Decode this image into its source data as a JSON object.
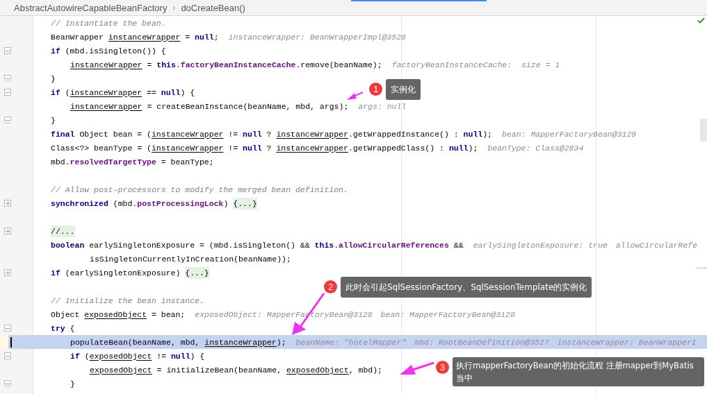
{
  "breadcrumb": {
    "class": "AbstractAutowireCapableBeanFactory",
    "separator": "›",
    "method": "doCreateBean()"
  },
  "lines": [
    {
      "current": false,
      "tokens": [
        {
          "text": "// Instantiate the bean.",
          "kind": "comment"
        }
      ]
    },
    {
      "current": false,
      "tokens": [
        {
          "text": "BeanWrapper ",
          "kind": "plain"
        },
        {
          "text": "instanceWrapper",
          "kind": "var"
        },
        {
          "text": " = ",
          "kind": "plain"
        },
        {
          "text": "null",
          "kind": "keyword"
        },
        {
          "text": ";",
          "kind": "plain"
        }
      ],
      "hints": [
        "instanceWrapper: BeanWrapperImpl@3528"
      ]
    },
    {
      "current": false,
      "fold": {
        "kind": "start",
        "collapsed": false
      },
      "tokens": [
        {
          "text": "if",
          "kind": "keyword"
        },
        {
          "text": " (mbd.isSingleton()) {",
          "kind": "plain"
        }
      ],
      "children": [
        {
          "current": false,
          "tokens": [
            {
              "text": "instanceWrapper",
              "kind": "var"
            },
            {
              "text": " = ",
              "kind": "plain"
            },
            {
              "text": "this",
              "kind": "keyword"
            },
            {
              "text": ".",
              "kind": "plain"
            },
            {
              "text": "factoryBeanInstanceCache",
              "kind": "field"
            },
            {
              "text": ".remove(beanName);",
              "kind": "plain"
            }
          ],
          "hints": [
            "factoryBeanInstanceCache:  size = 1"
          ]
        }
      ]
    },
    {
      "current": false,
      "fold": {
        "kind": "end"
      },
      "tokens": [
        {
          "text": "}",
          "kind": "plain"
        }
      ]
    },
    {
      "current": false,
      "fold": {
        "kind": "start",
        "collapsed": false
      },
      "tokens": [
        {
          "text": "if",
          "kind": "keyword"
        },
        {
          "text": " (",
          "kind": "plain"
        },
        {
          "text": "instanceWrapper",
          "kind": "var"
        },
        {
          "text": " == ",
          "kind": "plain"
        },
        {
          "text": "null",
          "kind": "keyword"
        },
        {
          "text": ") {",
          "kind": "plain"
        }
      ],
      "children": [
        {
          "current": false,
          "tokens": [
            {
              "text": "instanceWrapper",
              "kind": "var"
            },
            {
              "text": " = createBeanInstance(beanName, mbd, args);",
              "kind": "plain"
            }
          ],
          "hints": [
            "args: null"
          ]
        }
      ]
    },
    {
      "current": false,
      "fold": {
        "kind": "end"
      },
      "tokens": [
        {
          "text": "}",
          "kind": "plain"
        }
      ]
    },
    {
      "current": false,
      "tokens": [
        {
          "text": "final",
          "kind": "keyword"
        },
        {
          "text": " Object bean = (",
          "kind": "plain"
        },
        {
          "text": "instanceWrapper",
          "kind": "var"
        },
        {
          "text": " != ",
          "kind": "plain"
        },
        {
          "text": "null",
          "kind": "keyword"
        },
        {
          "text": " ? ",
          "kind": "plain"
        },
        {
          "text": "instanceWrapper",
          "kind": "var"
        },
        {
          "text": ".getWrappedInstance() : ",
          "kind": "plain"
        },
        {
          "text": "null",
          "kind": "keyword"
        },
        {
          "text": ");",
          "kind": "plain"
        }
      ],
      "hints": [
        "bean: MapperFactoryBean@3128"
      ]
    },
    {
      "current": false,
      "tokens": [
        {
          "text": "Class<?> beanType = (",
          "kind": "plain"
        },
        {
          "text": "instanceWrapper",
          "kind": "var"
        },
        {
          "text": " != ",
          "kind": "plain"
        },
        {
          "text": "null",
          "kind": "keyword"
        },
        {
          "text": " ? ",
          "kind": "plain"
        },
        {
          "text": "instanceWrapper",
          "kind": "var"
        },
        {
          "text": ".getWrappedClass() : ",
          "kind": "plain"
        },
        {
          "text": "null",
          "kind": "keyword"
        },
        {
          "text": ");",
          "kind": "plain"
        }
      ],
      "hints": [
        "beanType: Class@2834"
      ]
    },
    {
      "current": false,
      "tokens": [
        {
          "text": "mbd.",
          "kind": "plain"
        },
        {
          "text": "resolvedTargetType",
          "kind": "field"
        },
        {
          "text": " = beanType;",
          "kind": "plain"
        }
      ]
    },
    {
      "current": false,
      "blank_line_before": true,
      "tokens": [
        {
          "text": "// Allow post-processors to modify the merged bean definition.",
          "kind": "comment"
        }
      ]
    },
    {
      "current": false,
      "fold": {
        "kind": "start",
        "collapsed": true
      },
      "tokens": [
        {
          "text": "synchronized",
          "kind": "keyword"
        },
        {
          "text": " (mbd.",
          "kind": "plain"
        },
        {
          "text": "postProcessingLock",
          "kind": "field"
        },
        {
          "text": ") ",
          "kind": "plain"
        },
        {
          "text": "{...}",
          "kind": "folded"
        }
      ]
    },
    {
      "current": false,
      "blank_line_before": true,
      "fold": {
        "kind": "start",
        "collapsed": true
      },
      "tokens": [
        {
          "text": "//...",
          "kind": "folded"
        }
      ]
    },
    {
      "current": false,
      "tokens": [
        {
          "text": "boolean",
          "kind": "keyword"
        },
        {
          "text": " earlySingletonExposure = (mbd.isSingleton() && ",
          "kind": "plain"
        },
        {
          "text": "this",
          "kind": "keyword"
        },
        {
          "text": ".",
          "kind": "plain"
        },
        {
          "text": "allowCircularReferences",
          "kind": "field"
        },
        {
          "text": " &&",
          "kind": "plain"
        }
      ],
      "hints": [
        "earlySingletonExposure: true",
        "allowCircularRefe"
      ],
      "children": [
        {
          "children": [
            {
              "current": false,
              "tokens": [
                {
                  "text": "isSingletonCurrentlyInCreation(beanName));",
                  "kind": "plain"
                }
              ]
            }
          ]
        }
      ]
    },
    {
      "current": false,
      "fold": {
        "kind": "start",
        "collapsed": true
      },
      "tokens": [
        {
          "text": "if",
          "kind": "keyword"
        },
        {
          "text": " (earlySingletonExposure) ",
          "kind": "plain"
        },
        {
          "text": "{...}",
          "kind": "folded"
        }
      ]
    },
    {
      "current": false,
      "blank_line_before": true,
      "tokens": [
        {
          "text": "// Initialize the bean instance.",
          "kind": "comment"
        }
      ]
    },
    {
      "current": false,
      "tokens": [
        {
          "text": "Object ",
          "kind": "plain"
        },
        {
          "text": "exposedObject",
          "kind": "var"
        },
        {
          "text": " = bean;",
          "kind": "plain"
        }
      ],
      "hints": [
        "exposedObject: MapperFactoryBean@3128",
        "bean: MapperFactoryBean@3128"
      ]
    },
    {
      "current": false,
      "fold": {
        "kind": "start",
        "collapsed": false
      },
      "tokens": [
        {
          "text": "try",
          "kind": "keyword"
        },
        {
          "text": " {",
          "kind": "plain"
        }
      ],
      "children": [
        {
          "current": true,
          "tokens": [
            {
              "text": "populateBean(beanName, mbd, ",
              "kind": "plain"
            },
            {
              "text": "instanceWrapper",
              "kind": "var"
            },
            {
              "text": ");",
              "kind": "plain"
            }
          ],
          "hints": [
            "beanName: \"hotelMapper\"",
            "mbd: RootBeanDefinition@3527",
            "instanceWrapper: BeanWrapperI"
          ]
        },
        {
          "current": false,
          "fold": {
            "kind": "start",
            "collapsed": false
          },
          "tokens": [
            {
              "text": "if",
              "kind": "keyword"
            },
            {
              "text": " (",
              "kind": "plain"
            },
            {
              "text": "exposedObject",
              "kind": "var"
            },
            {
              "text": " != ",
              "kind": "plain"
            },
            {
              "text": "null",
              "kind": "keyword"
            },
            {
              "text": ") {",
              "kind": "plain"
            }
          ],
          "children": [
            {
              "current": false,
              "tokens": [
                {
                  "text": "exposedObject",
                  "kind": "var"
                },
                {
                  "text": " = initializeBean(beanName, ",
                  "kind": "plain"
                },
                {
                  "text": "exposedObject",
                  "kind": "var"
                },
                {
                  "text": ", mbd);",
                  "kind": "plain"
                }
              ]
            }
          ]
        },
        {
          "current": false,
          "fold": {
            "kind": "end"
          },
          "tokens": [
            {
              "text": "}",
              "kind": "plain"
            }
          ]
        }
      ]
    }
  ],
  "annotations": [
    {
      "number": "1",
      "text": "实例化"
    },
    {
      "number": "2",
      "text": "此时会引起SqlSessionFactory、SqlSessionTemplate的实例化"
    },
    {
      "number": "3",
      "text": "执行mapperFactoryBean的初始化流程 注册mapper到MyBatis当中"
    }
  ]
}
